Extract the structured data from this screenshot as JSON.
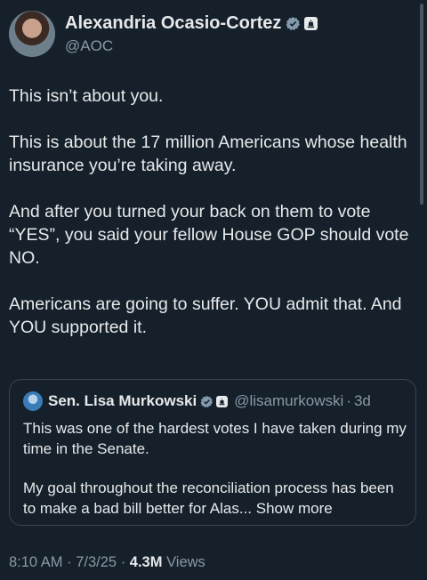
{
  "author": {
    "display_name": "Alexandria Ocasio-Cortez",
    "handle": "@AOC"
  },
  "tweet": {
    "paragraphs": [
      "This isn’t about you.",
      "This is about the 17 million Americans whose health insurance you’re taking away.",
      "And after you turned your back on them to vote “YES”, you said your fellow House GOP should vote NO.",
      "Americans are going to suffer. YOU admit that. And YOU supported it."
    ]
  },
  "quote": {
    "display_name": "Sen. Lisa Murkowski",
    "handle": "@lisamurkowski",
    "separator": "·",
    "age": "3d",
    "paragraphs": [
      "This was one of the hardest votes I have taken during my time in the Senate.",
      "My goal throughout the reconciliation process has been to make a bad bill better for Alas..."
    ],
    "show_more": "Show more"
  },
  "meta": {
    "time": "8:10 AM",
    "separator": "·",
    "date": "7/3/25",
    "views_count": "4.3M",
    "views_label": "Views"
  },
  "colors": {
    "background": "#15202b",
    "text": "#e7e9ea",
    "muted": "#8b98a5",
    "verified": "#829aab",
    "border": "#38444d"
  },
  "icons": {
    "verified": "verified-badge-icon",
    "affiliation": "capitol-affiliation-icon"
  }
}
